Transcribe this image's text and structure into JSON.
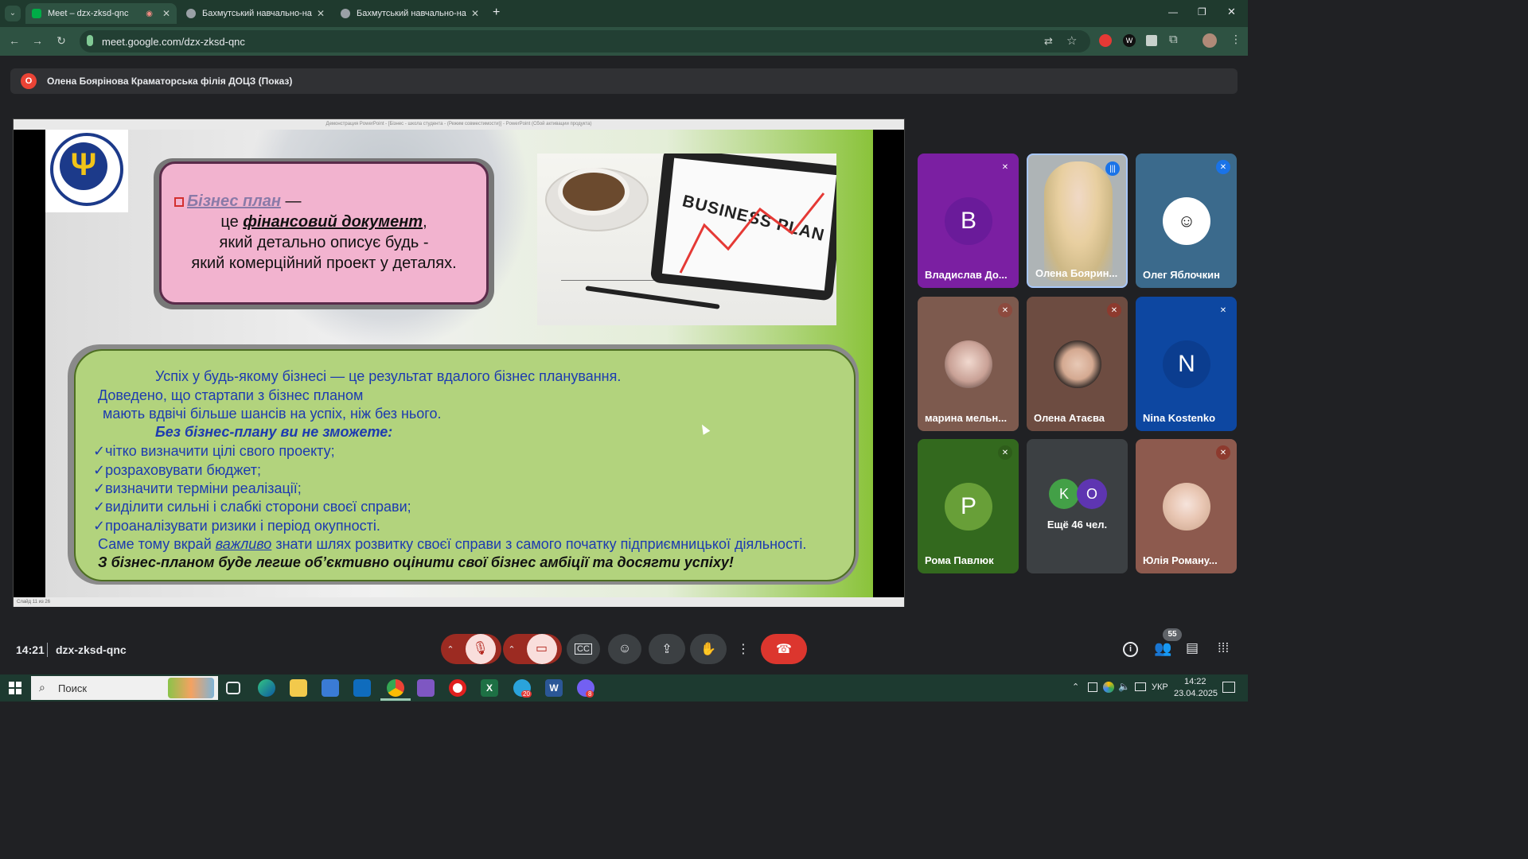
{
  "browser": {
    "tabs": [
      {
        "title": "Meet – dzx-zksd-qnc",
        "active": true
      },
      {
        "title": "Бахмутський навчально-наук",
        "active": false
      },
      {
        "title": "Бахмутський навчально-наук",
        "active": false
      }
    ],
    "url": "meet.google.com/dzx-zksd-qnc"
  },
  "meet": {
    "presenter_bar": {
      "badge": "O",
      "text": "Олена Боярінова Краматорська філія ДОЦЗ (Показ)"
    },
    "slide": {
      "pp_window_title": "Демонстрация PowerPoint - [Бізнес - школа студента - (Режим совместимости)] - PowerPoint (Сбой активации продукта)",
      "status": "Слайд 11 из 26",
      "logo_text": "ДЕРЖАВНА СЛУЖБА ЗАЙНЯТОСТІ",
      "pink": {
        "term": "Бізнес план",
        "dash": " —",
        "line2a": "це ",
        "line2b": "фінансовий документ",
        "line2c": ",",
        "line3": "який детально описує будь -",
        "line4": "який комерційний проект у деталях."
      },
      "photo_text": "BUSINESS PLAN",
      "green": {
        "l1": "Успіх у будь-якому бізнесі — це результат вдалого бізнес планування.",
        "l2": "Доведено, що стартапи з бізнес планом",
        "l3": "мають вдвічі більше шансів на успіх, ніж без нього.",
        "l4": "Без бізнес-плану ви не зможете:",
        "items": [
          "✓чітко визначити цілі свого проекту;",
          "✓розраховувати бюджет;",
          "✓визначити терміни реалізації;",
          "✓виділити сильні і слабкі сторони своєї справи;",
          "✓проаналізувати ризики і період окупності."
        ],
        "l10a": "Саме тому вкрай ",
        "l10b": "важливо",
        "l10c": " знати шлях розвитку своєї справи з самого початку підприємницької діяльності.",
        "l11": "З бізнес-планом буде легше об’єктивно оцінити свої бізнес амбіції та досягти успіху!"
      }
    },
    "participants": [
      {
        "name": "Владислав До...",
        "initial": "B",
        "bg": "#7b1fa2",
        "avatar_bg": "#6a1b9a"
      },
      {
        "name": "Олена Боярин...",
        "initial": "",
        "bg": "#9ca3a8",
        "avatar_bg": ""
      },
      {
        "name": "Олег Яблочкин",
        "initial": "",
        "bg": "#3b6a8c",
        "avatar_bg": "#ffffff"
      },
      {
        "name": "марина мельн...",
        "initial": "",
        "bg": "#7d5a4e",
        "avatar_bg": "#d9c3b8"
      },
      {
        "name": "Олена Атаєва",
        "initial": "",
        "bg": "#6d4c41",
        "avatar_bg": "#e8d6cc"
      },
      {
        "name": "Nina Kostenko",
        "initial": "N",
        "bg": "#0d47a1",
        "avatar_bg": "#0b3d8f"
      },
      {
        "name": "Рома Павлюк",
        "initial": "P",
        "bg": "#33691e",
        "avatar_bg": "#689f38"
      },
      {
        "name": "Ещё 46 чел.",
        "initial": "",
        "bg": "#3c4043",
        "avatar_bg": ""
      },
      {
        "name": "Юлія Роману...",
        "initial": "",
        "bg": "#8d5a4e",
        "avatar_bg": "#f1e0d8"
      }
    ],
    "more_avatars": [
      "K",
      "O"
    ],
    "time": "14:21",
    "meeting_code": "dzx-zksd-qnc",
    "people_count": "55"
  },
  "taskbar": {
    "search_placeholder": "Поиск",
    "lang": "УКР",
    "time": "14:22",
    "date": "23.04.2025",
    "badges": {
      "telegram": "20",
      "viber": "8"
    }
  }
}
